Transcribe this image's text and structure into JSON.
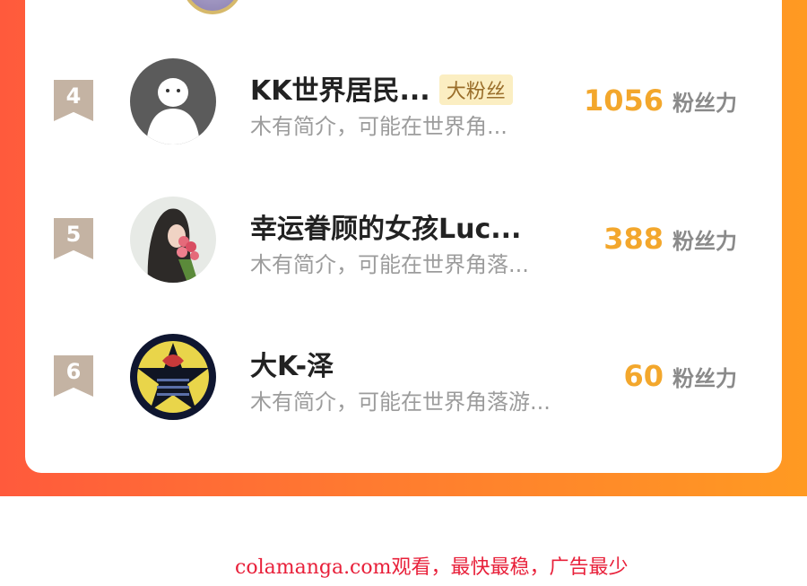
{
  "fans": [
    {
      "rank": "4",
      "name": "KK世界居民...",
      "tag": "大粉丝",
      "bio": "木有简介，可能在世界角...",
      "score": "1056",
      "unit": "粉丝力"
    },
    {
      "rank": "5",
      "name": "幸运眷顾的女孩Luc...",
      "tag": "",
      "bio": "木有简介，可能在世界角落...",
      "score": "388",
      "unit": "粉丝力"
    },
    {
      "rank": "6",
      "name": "大K-泽",
      "tag": "",
      "bio": "木有简介，可能在世界角落游...",
      "score": "60",
      "unit": "粉丝力"
    }
  ],
  "watermark": "colamanga.com观看，最快最稳，广告最少",
  "colors": {
    "accent": "#f3a72c",
    "banner_start": "#ff5a3c",
    "banner_end": "#ff9a22",
    "badge": "#c4b3a3"
  }
}
